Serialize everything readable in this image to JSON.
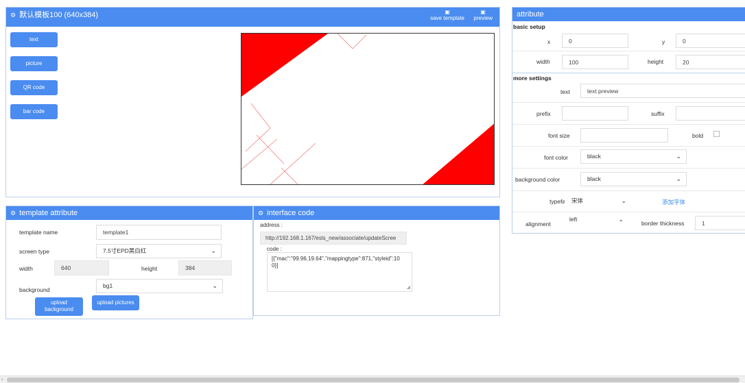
{
  "editor": {
    "title": "默认模板100 (640x384)",
    "save_template": "save template",
    "preview": "preview",
    "components": [
      "text",
      "picture",
      "QR code",
      "bar code"
    ]
  },
  "template_attr": {
    "title": "template attribute",
    "name_label": "template name",
    "name_value": "template1",
    "screen_label": "screen type",
    "screen_value": "7.5寸EPD黑白红",
    "width_label": "width",
    "width_value": "640",
    "height_label": "height",
    "height_value": "384",
    "bg_label": "background",
    "bg_value": "bg1",
    "upload_bg_line1": "upload",
    "upload_bg_line2": "background",
    "upload_pictures": "upload pictures"
  },
  "interface": {
    "title": "interface code",
    "address_label": "address :",
    "address_value": "http://192.168.1.167/esls_new/associate/updateScree",
    "code_label": "code :",
    "code_line1": "[{\"mac\":\"99.96.19.64\",\"mappingtype\":871,\"styleid\":10",
    "code_line2": "0}]"
  },
  "attribute": {
    "title": "attribute",
    "basic_setup": "basic setup",
    "x_label": "x",
    "x_value": "0",
    "y_label": "y",
    "y_value": "0",
    "width_label": "width",
    "width_value": "100",
    "height_label": "height",
    "height_value": "20",
    "more_settings": "more settings",
    "text_label": "text",
    "text_value": "text preview",
    "prefix_label": "prefix",
    "prefix_value": "",
    "suffix_label": "suffix",
    "suffix_value": "",
    "font_size_label": "font size",
    "font_size_value": "",
    "bold_label": "bold",
    "font_color_label": "font color",
    "font_color_value": "black",
    "bg_color_label": "background color",
    "bg_color_value": "black",
    "typeface_label": "typeface",
    "typeface_value": "宋体",
    "add_font": "添加字体",
    "alignment_label": "alignment",
    "alignment_value": "left",
    "border_label": "border thickness",
    "border_value": "1"
  },
  "colors": {
    "header": "#4a8cf0",
    "accent_red": "#ff0000",
    "link": "#3b8be8"
  },
  "icons": {
    "settings": "gear-icon",
    "save": "floppy-icon",
    "dropdown": "chevron-down-icon"
  }
}
